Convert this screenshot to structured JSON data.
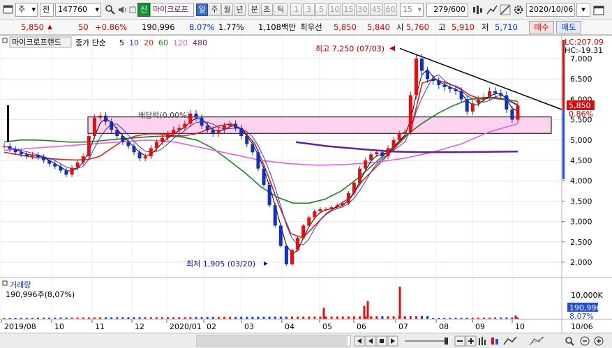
{
  "toolbar": {
    "mode": "주",
    "market": "전",
    "code": "147760",
    "new_badge": "신",
    "stock_name": "마이크로프",
    "periods": [
      "일",
      "주",
      "월",
      "년",
      "분",
      "초",
      "틱"
    ],
    "active_period": "일",
    "minute_options": [
      "1",
      "3",
      "5",
      "10",
      "15",
      "30",
      "45",
      "60"
    ],
    "interval_value": "15",
    "page_counter": "279",
    "page_total": "/600",
    "date": "2020/10/06"
  },
  "quote": {
    "price": "5,850",
    "change": "50",
    "change_pct": "+0.86%",
    "volume": "190,996",
    "turnover_pct": "8.07%",
    "ratio_pct": "1.77%",
    "amount": "1,108백만",
    "best_bid_label": "최우선",
    "ask": "5,850",
    "bid": "5,840",
    "open_label": "시",
    "open": "5,760",
    "high_label": "고",
    "high": "5,910",
    "low_label": "저",
    "low": "5,710",
    "buy_label": "매수",
    "sell_label": "매도"
  },
  "chart_header": {
    "stock_tag": "마이크로프랜드",
    "legend_prefix": "종가 단순",
    "ma": [
      {
        "label": "5",
        "color": "#000000"
      },
      {
        "label": "10",
        "color": "#3a3ad0"
      },
      {
        "label": "20",
        "color": "#e02020"
      },
      {
        "label": "60",
        "color": "#208020"
      },
      {
        "label": "120",
        "color": "#e060e0"
      },
      {
        "label": "480",
        "color": "#6020a0"
      }
    ]
  },
  "annotations": {
    "high": "최고 7,250 (07/03)",
    "low": "최저 1,905 (03/20)",
    "dividend": "배당락(0.00%)",
    "lc": "LC:207.09",
    "hc": "HC:-19.31"
  },
  "price_axis": {
    "ticks": [
      "7,000",
      "6,500",
      "6,000",
      "5,500",
      "5,000",
      "4,500",
      "4,000",
      "3,500",
      "3,000",
      "2,500",
      "2,000"
    ],
    "current_price": "5,850",
    "current_pct": "0.86%"
  },
  "volume_panel": {
    "title": "거래량",
    "summary": "190,996주(8,07%)",
    "axis_label": "10,000K",
    "current_volume": "190,996",
    "current_pct": "8.07%"
  },
  "date_axis": {
    "labels": [
      "2019/08",
      "10",
      "11",
      "12",
      "2020/01",
      "02",
      "03",
      "04",
      "05",
      "06",
      "07",
      "08",
      "09",
      "10",
      "10/06"
    ]
  },
  "chart_data": {
    "type": "candlestick",
    "title": "마이크로프랜드",
    "period": "daily",
    "x_start": "2019/08",
    "x_end": "2020/10/06",
    "ylim": [
      1800,
      7300
    ],
    "closes": [
      4850,
      4780,
      4700,
      4650,
      4600,
      4640,
      4580,
      4500,
      4420,
      4350,
      4250,
      4150,
      4320,
      4450,
      4600,
      5100,
      5550,
      5600,
      5450,
      5250,
      5100,
      4950,
      4850,
      4700,
      4550,
      4600,
      4800,
      4950,
      5050,
      5150,
      5250,
      5300,
      5400,
      5650,
      5550,
      5350,
      5250,
      5150,
      5250,
      5350,
      5400,
      5300,
      5100,
      4900,
      4700,
      4300,
      3900,
      3400,
      2900,
      2400,
      1950,
      2300,
      2600,
      2900,
      3100,
      3250,
      3300,
      3300,
      3350,
      3400,
      3450,
      3700,
      3950,
      4300,
      4500,
      4650,
      4700,
      4600,
      4800,
      5000,
      5150,
      5200,
      6100,
      7000,
      6700,
      6500,
      6450,
      6350,
      6300,
      6250,
      6200,
      6000,
      5700,
      5900,
      6000,
      6050,
      6200,
      6150,
      6100,
      5750,
      5500,
      5850
    ],
    "ma_series": [
      {
        "name": "20",
        "values": [
          4700,
          4650,
          4600,
          4560,
          4540,
          4520,
          4510,
          4520,
          4600,
          4800,
          5000,
          5100,
          5150,
          5150,
          5120,
          5100,
          5150,
          5250,
          5350,
          5400,
          5250,
          4900,
          4200,
          3400,
          2700,
          2600,
          2900,
          3200,
          3400,
          3600,
          4000,
          4300,
          4600,
          4900,
          5200,
          6400,
          6500,
          6400,
          6300,
          6100,
          6000,
          6050,
          6000,
          5850
        ]
      },
      {
        "name": "60",
        "values": [
          4950,
          5000,
          5000,
          4980,
          4950,
          4950,
          4980,
          5020,
          5050,
          5080,
          5100,
          5080,
          5000,
          4800,
          4500,
          4200,
          3850,
          3600,
          3450,
          3450,
          3550,
          3750,
          4050,
          4400,
          4750,
          5100,
          5400,
          5650,
          5850,
          6000,
          6050,
          6000,
          5950
        ]
      },
      {
        "name": "120",
        "values": [
          4750,
          4800,
          4850,
          4900,
          4950,
          5000,
          4950,
          4800,
          4650,
          4500,
          4420,
          4380,
          4400,
          4450,
          4550,
          4700,
          4900,
          5200,
          5400
        ]
      },
      {
        "name": "480",
        "values": [
          4950,
          4850,
          4780,
          4720,
          4700,
          4700,
          4710,
          4720
        ]
      }
    ],
    "resistance_trendline": {
      "from": "2020/07/03",
      "to": "2020/10/06",
      "start": 7250,
      "end": 5850
    },
    "support_box": {
      "upper": 5550,
      "lower": 5300
    },
    "volume_spikes": [
      {
        "period": "2020/05",
        "value": 3400000
      },
      {
        "period": "2020/06",
        "value": 4000000
      },
      {
        "period": "2020/06",
        "value": 5500000
      },
      {
        "period": "2020/07",
        "value": 10000000
      },
      {
        "period": "2020/10",
        "value": 1000000
      }
    ]
  }
}
